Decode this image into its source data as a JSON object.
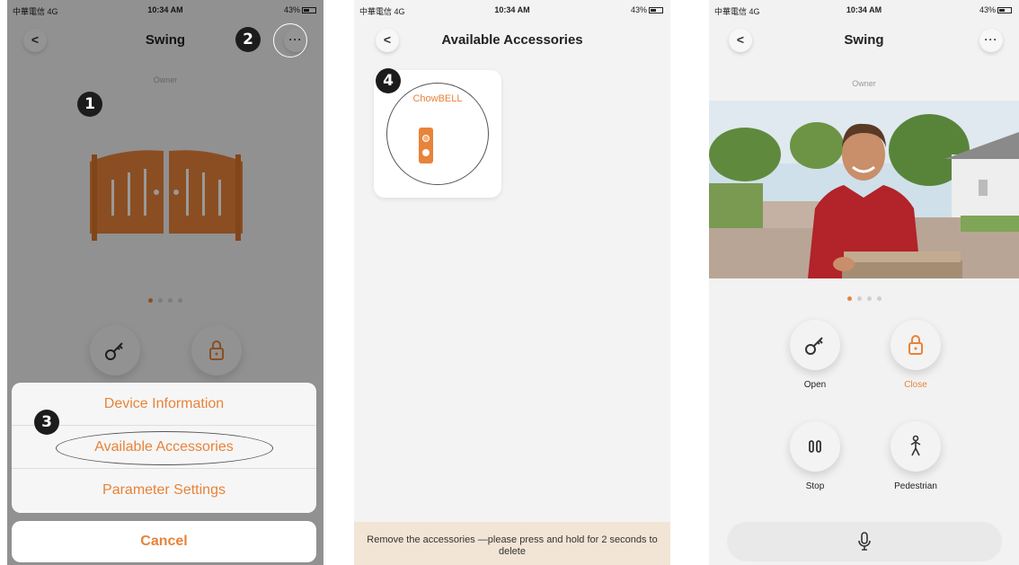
{
  "status": {
    "carrier": "中華電信 4G",
    "time": "10:34 AM",
    "battery": "43%"
  },
  "panel1": {
    "title": "Swing",
    "back": "<",
    "more": "···",
    "owner": "Owner",
    "sheet_items": [
      "Device Information",
      "Available Accessories",
      "Parameter Settings"
    ],
    "cancel": "Cancel",
    "markers": [
      "1",
      "2",
      "3"
    ]
  },
  "panel2": {
    "title": "Available Accessories",
    "back": "<",
    "marker": "4",
    "accessory_name": "ChowBELL",
    "hint": "Remove the accessories —please press and hold for 2 seconds to delete"
  },
  "panel3": {
    "title": "Swing",
    "back": "<",
    "more": "···",
    "owner": "Owner",
    "controls": {
      "open": "Open",
      "close": "Close",
      "stop": "Stop",
      "pedestrian": "Pedestrian"
    }
  },
  "colors": {
    "accent": "#e8833a",
    "marker": "#1c1c1c"
  },
  "icons": [
    "back-icon",
    "more-icon",
    "gate-icon",
    "key-icon",
    "lock-icon",
    "doorbell-icon",
    "pause-icon",
    "pedestrian-icon",
    "mic-icon"
  ]
}
